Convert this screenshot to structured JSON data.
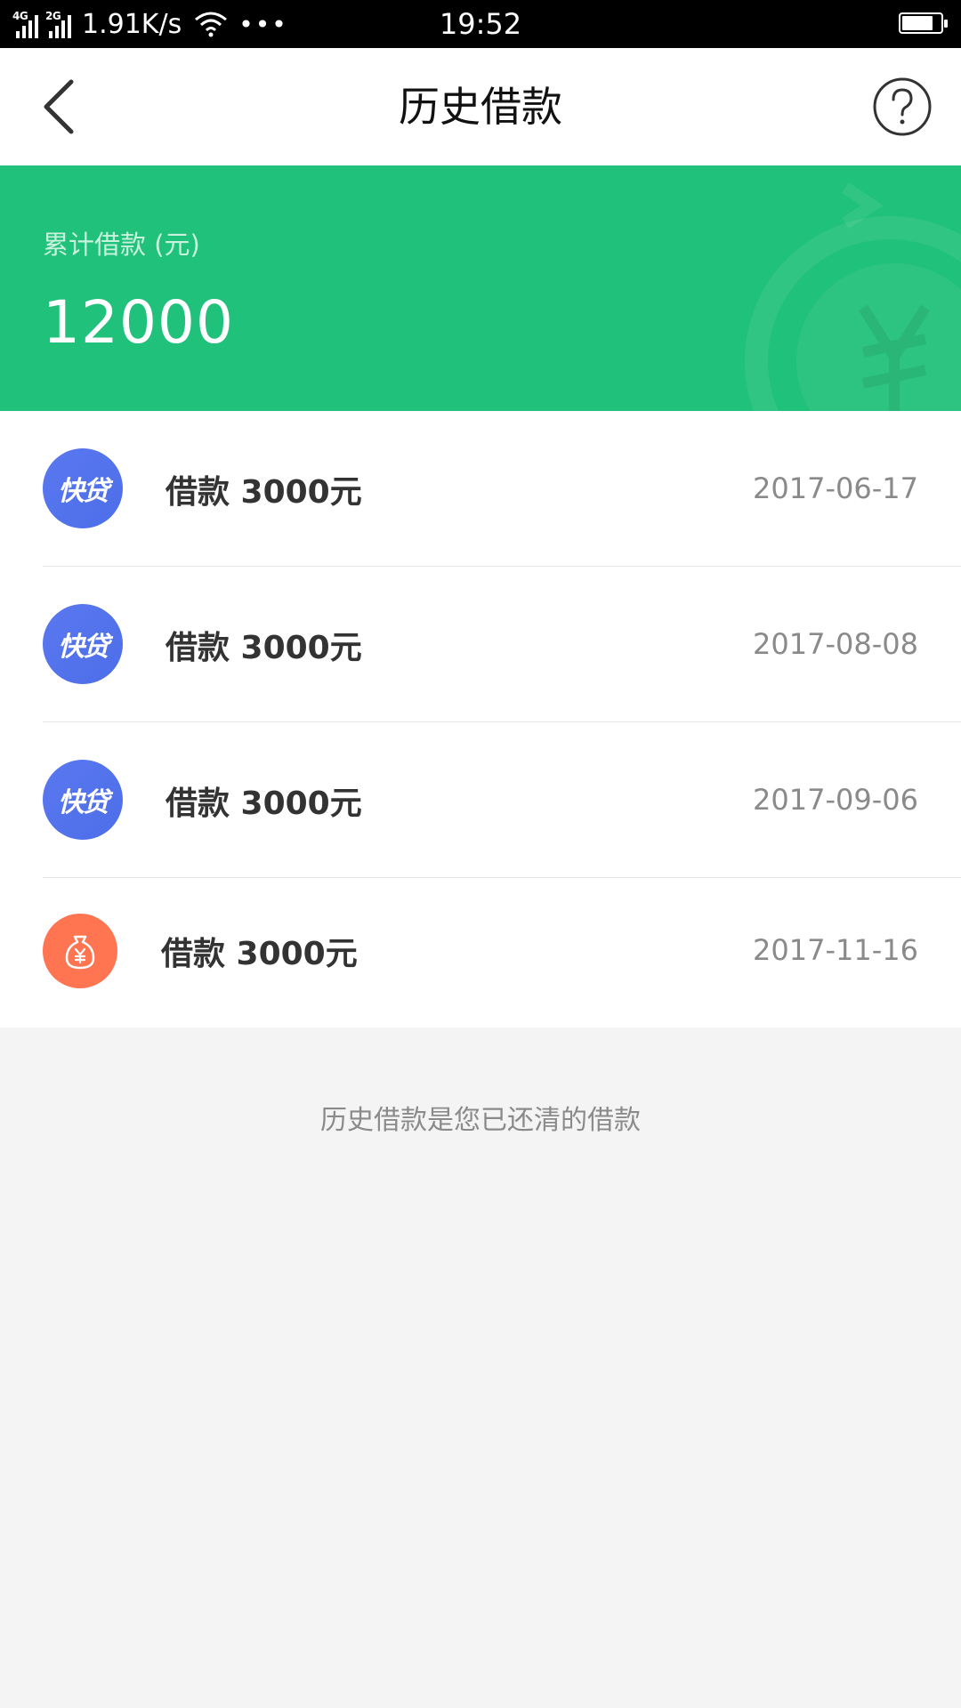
{
  "status_bar": {
    "net1": "4G",
    "net2": "2G",
    "speed": "1.91K/s",
    "more": "•••",
    "time": "19:52"
  },
  "header": {
    "title": "历史借款",
    "back_icon": "chevron-left-icon",
    "help_icon": "question-circle-icon"
  },
  "summary": {
    "label": "累计借款 (元)",
    "value": "12000",
    "bg_color": "#20c17a"
  },
  "loans": [
    {
      "icon": "kuaidai-logo",
      "logo_text": "快贷",
      "title": "借款 3000元",
      "date": "2017-06-17"
    },
    {
      "icon": "kuaidai-logo",
      "logo_text": "快贷",
      "title": "借款 3000元",
      "date": "2017-08-08"
    },
    {
      "icon": "kuaidai-logo",
      "logo_text": "快贷",
      "title": "借款 3000元",
      "date": "2017-09-06"
    },
    {
      "icon": "money-bag-icon",
      "title": "借款 3000元",
      "date": "2017-11-16"
    }
  ],
  "footer_note": "历史借款是您已还清的借款"
}
